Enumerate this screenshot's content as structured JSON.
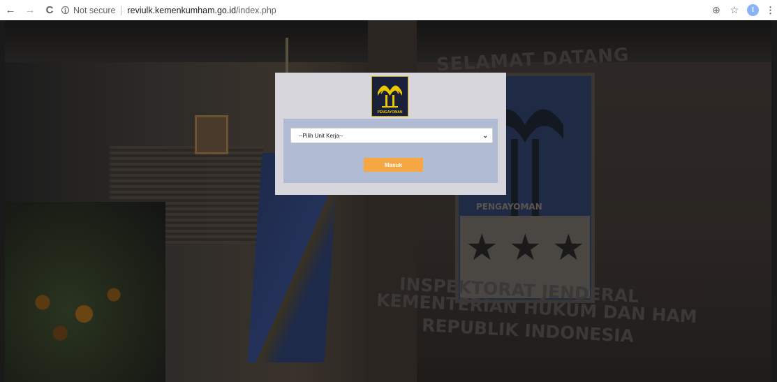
{
  "browser": {
    "back_icon": "←",
    "forward_icon": "→",
    "reload_icon": "C",
    "info_icon": "i",
    "security_text": "Not secure",
    "url_host": "reviulk.kemenkumham.go.id",
    "url_path": "/index.php",
    "zoom_icon": "⊕",
    "star_icon": "☆",
    "profile_initial": "I",
    "menu_icon": "⋮"
  },
  "login": {
    "logo_label": "PENGAYOMAN",
    "unit_select_value": "--Pilih Unit Kerja--",
    "submit_label": "Masuk",
    "colors": {
      "submit": "#f5a743",
      "inner_panel": "#b0bcd4",
      "outer_panel": "#d6d6dc"
    }
  },
  "background": {
    "banner_top": "SELAMAT DATANG",
    "emblem_label": "PENGAYOMAN",
    "org_line1": "INSPEKTORAT JENDERAL",
    "org_line2": "KEMENTERIAN HUKUM DAN HAM",
    "org_line3": "REPUBLIK INDONESIA"
  }
}
